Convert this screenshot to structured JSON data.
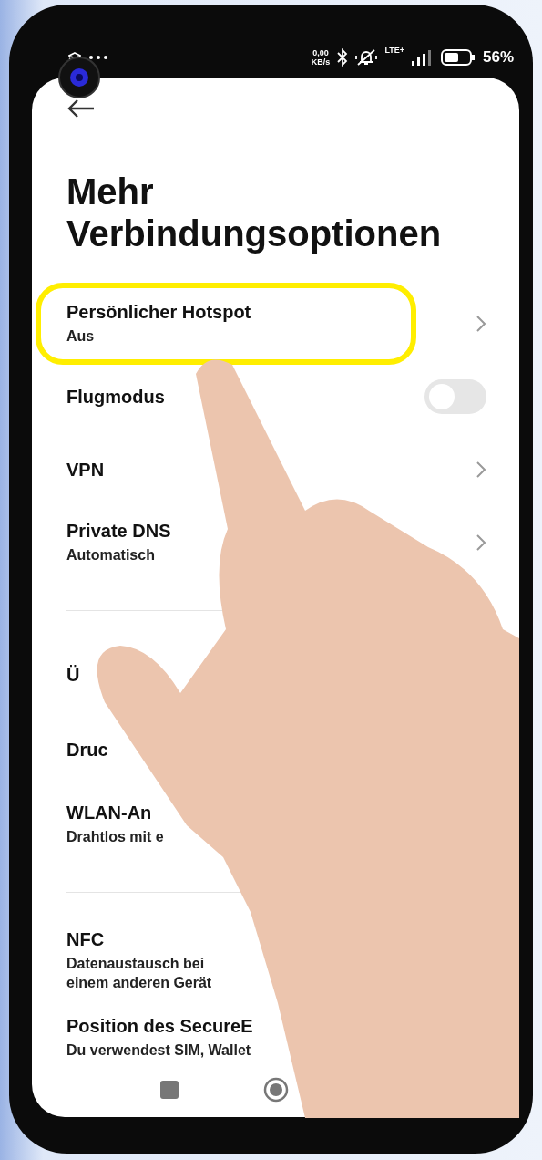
{
  "status_bar": {
    "speed_value": "0,00",
    "speed_unit": "KB/s",
    "network": "LTE+",
    "battery_text": "56%"
  },
  "title": "Mehr Verbindungsoptionen",
  "sections": [
    {
      "items": [
        {
          "kind": "nav",
          "title": "Persönlicher Hotspot",
          "subtitle": "Aus",
          "highlighted": true
        },
        {
          "kind": "toggle",
          "title": "Flugmodus",
          "on": false,
          "highlighted": false
        },
        {
          "kind": "nav",
          "title": "VPN",
          "highlighted": false
        },
        {
          "kind": "nav",
          "title": "Private DNS",
          "subtitle": "Automatisch",
          "highlighted": false
        }
      ]
    },
    {
      "items": [
        {
          "kind": "plain",
          "title": "Ü",
          "highlighted": false
        },
        {
          "kind": "plain",
          "title": "Druc",
          "highlighted": false
        },
        {
          "kind": "plain",
          "title": "WLAN-An",
          "subtitle": "Drahtlos mit e",
          "highlighted": false
        }
      ]
    },
    {
      "items": [
        {
          "kind": "plain",
          "title": "NFC",
          "subtitle": "Datenaustausch bei\neinem anderen Gerät",
          "highlighted": false
        },
        {
          "kind": "plain",
          "title": "Position des SecureE",
          "subtitle": "Du verwendest SIM, Wallet",
          "highlighted": false
        }
      ]
    }
  ]
}
